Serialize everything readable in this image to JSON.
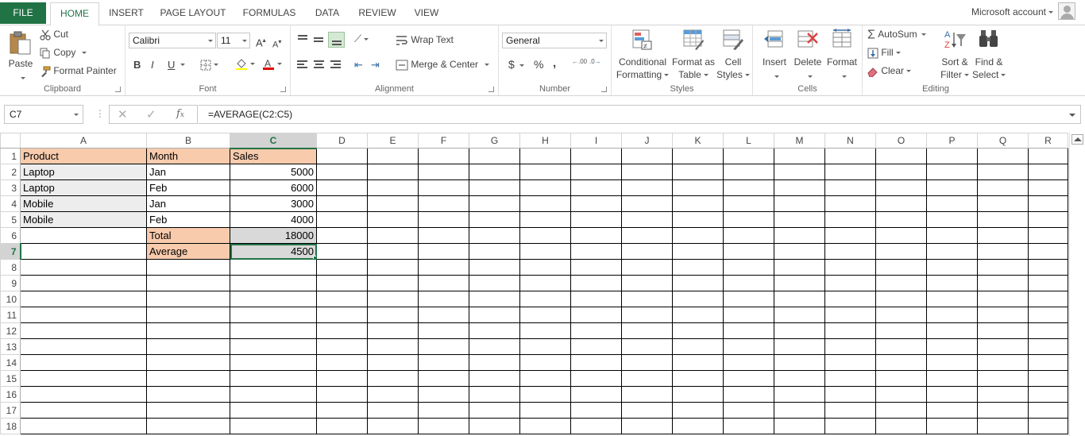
{
  "tabs": {
    "file": "FILE",
    "home": "HOME",
    "insert": "INSERT",
    "page_layout": "PAGE LAYOUT",
    "formulas": "FORMULAS",
    "data": "DATA",
    "review": "REVIEW",
    "view": "VIEW"
  },
  "account": "Microsoft account",
  "clipboard": {
    "label": "Clipboard",
    "paste": "Paste",
    "cut": "Cut",
    "copy": "Copy",
    "format_painter": "Format Painter"
  },
  "font": {
    "label": "Font",
    "family": "Calibri",
    "size": "11",
    "bold": "B",
    "italic": "I",
    "underline": "U",
    "grow": "A",
    "shrink": "A"
  },
  "alignment": {
    "label": "Alignment",
    "wrap": "Wrap Text",
    "merge": "Merge & Center"
  },
  "number": {
    "label": "Number",
    "format": "General",
    "currency": "$",
    "percent": "%",
    "comma": ",",
    "inc_dec": ".00",
    "dec_dec": ".0"
  },
  "styles": {
    "label": "Styles",
    "conditional": [
      "Conditional",
      "Formatting"
    ],
    "format_table": [
      "Format as",
      "Table"
    ],
    "cell_styles": [
      "Cell",
      "Styles"
    ]
  },
  "cells": {
    "label": "Cells",
    "insert": "Insert",
    "delete": "Delete",
    "format": "Format"
  },
  "editing": {
    "label": "Editing",
    "autosum": "AutoSum",
    "fill": "Fill",
    "clear": "Clear",
    "sort": [
      "Sort &",
      "Filter"
    ],
    "find": [
      "Find &",
      "Select"
    ]
  },
  "namebox": "C7",
  "formula": "=AVERAGE(C2:C5)",
  "columns": [
    "A",
    "B",
    "C",
    "D",
    "E",
    "F",
    "G",
    "H",
    "I",
    "J",
    "K",
    "L",
    "M",
    "N",
    "O",
    "P",
    "Q",
    "R"
  ],
  "rows": [
    {
      "n": "1",
      "a": "Product",
      "b": "Month",
      "c": "Sales"
    },
    {
      "n": "2",
      "a": "Laptop",
      "b": "Jan",
      "c": "5000"
    },
    {
      "n": "3",
      "a": "Laptop",
      "b": "Feb",
      "c": "6000"
    },
    {
      "n": "4",
      "a": "Mobile",
      "b": "Jan",
      "c": "3000"
    },
    {
      "n": "5",
      "a": "Mobile",
      "b": "Feb",
      "c": "4000"
    },
    {
      "n": "6",
      "a": "",
      "b": "Total",
      "c": "18000"
    },
    {
      "n": "7",
      "a": "",
      "b": "Average",
      "c": "4500"
    },
    {
      "n": "8"
    },
    {
      "n": "9"
    },
    {
      "n": "10"
    },
    {
      "n": "11"
    },
    {
      "n": "12"
    },
    {
      "n": "13"
    },
    {
      "n": "14"
    },
    {
      "n": "15"
    },
    {
      "n": "16"
    },
    {
      "n": "17"
    },
    {
      "n": "18"
    }
  ],
  "colors": {
    "accent": "#217346",
    "header_fill": "#f8cbad",
    "data_fill": "#ededed"
  }
}
